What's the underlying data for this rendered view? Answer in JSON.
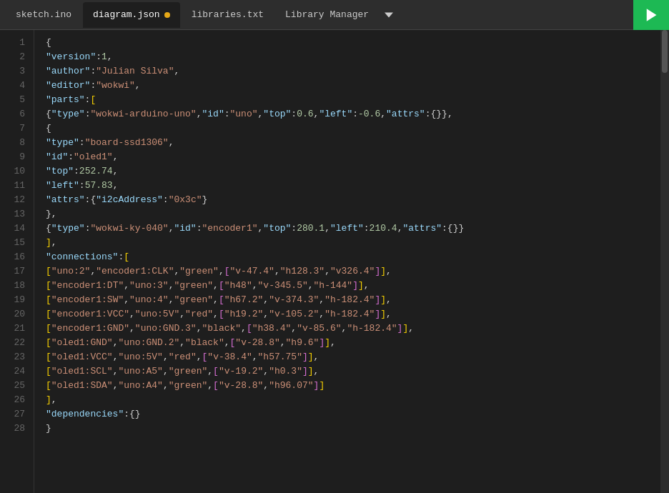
{
  "tabs": [
    {
      "id": "sketch",
      "label": "sketch.ino",
      "active": false,
      "modified": false
    },
    {
      "id": "diagram",
      "label": "diagram.json",
      "active": true,
      "modified": true
    },
    {
      "id": "libraries",
      "label": "libraries.txt",
      "active": false,
      "modified": false
    },
    {
      "id": "libmanager",
      "label": "Library Manager",
      "active": false,
      "modified": false
    }
  ],
  "run_button_title": "Run",
  "lines": [
    {
      "num": 1,
      "html": "<span class='s-brace'>{</span>"
    },
    {
      "num": 2,
      "html": "  <span class='s-key'>\"version\"</span><span class='s-colon'>:</span> <span class='s-num'>1</span><span class='s-comma'>,</span>"
    },
    {
      "num": 3,
      "html": "  <span class='s-key'>\"author\"</span><span class='s-colon'>:</span> <span class='s-str'>\"Julian Silva\"</span><span class='s-comma'>,</span>"
    },
    {
      "num": 4,
      "html": "  <span class='s-key'>\"editor\"</span><span class='s-colon'>:</span> <span class='s-str'>\"wokwi\"</span><span class='s-comma'>,</span>"
    },
    {
      "num": 5,
      "html": "  <span class='s-key'>\"parts\"</span><span class='s-colon'>:</span> <span class='s-bracket'>[</span>"
    },
    {
      "num": 6,
      "html": "    <span class='s-brace'>{</span> <span class='s-key'>\"type\"</span><span class='s-colon'>:</span> <span class='s-str'>\"wokwi-arduino-uno\"</span><span class='s-comma'>,</span> <span class='s-key'>\"id\"</span><span class='s-colon'>:</span> <span class='s-str'>\"uno\"</span><span class='s-comma'>,</span> <span class='s-key'>\"top\"</span><span class='s-colon'>:</span> <span class='s-num'>0.6</span><span class='s-comma'>,</span> <span class='s-key'>\"left\"</span><span class='s-colon'>:</span> <span class='s-num'>-0.6</span><span class='s-comma'>,</span> <span class='s-key'>\"attrs\"</span><span class='s-colon'>:</span> <span class='s-brace'>{}</span> <span class='s-brace'>}</span><span class='s-comma'>,</span>"
    },
    {
      "num": 7,
      "html": "    <span class='s-brace'>{</span>"
    },
    {
      "num": 8,
      "html": "      <span class='s-key'>\"type\"</span><span class='s-colon'>:</span> <span class='s-str'>\"board-ssd1306\"</span><span class='s-comma'>,</span>"
    },
    {
      "num": 9,
      "html": "      <span class='s-key'>\"id\"</span><span class='s-colon'>:</span> <span class='s-str'>\"oled1\"</span><span class='s-comma'>,</span>"
    },
    {
      "num": 10,
      "html": "      <span class='s-key'>\"top\"</span><span class='s-colon'>:</span> <span class='s-num'>252.74</span><span class='s-comma'>,</span>"
    },
    {
      "num": 11,
      "html": "      <span class='s-key'>\"left\"</span><span class='s-colon'>:</span> <span class='s-num'>57.83</span><span class='s-comma'>,</span>"
    },
    {
      "num": 12,
      "html": "      <span class='s-key'>\"attrs\"</span><span class='s-colon'>:</span> <span class='s-brace'>{</span> <span class='s-key'>\"i2cAddress\"</span><span class='s-colon'>:</span> <span class='s-str'>\"0x3c\"</span> <span class='s-brace'>}</span>"
    },
    {
      "num": 13,
      "html": "    <span class='s-brace'>}</span><span class='s-comma'>,</span>"
    },
    {
      "num": 14,
      "html": "    <span class='s-brace'>{</span> <span class='s-key'>\"type\"</span><span class='s-colon'>:</span> <span class='s-str'>\"wokwi-ky-040\"</span><span class='s-comma'>,</span> <span class='s-key'>\"id\"</span><span class='s-colon'>:</span> <span class='s-str'>\"encoder1\"</span><span class='s-comma'>,</span> <span class='s-key'>\"top\"</span><span class='s-colon'>:</span> <span class='s-num'>280.1</span><span class='s-comma'>,</span> <span class='s-key'>\"left\"</span><span class='s-colon'>:</span> <span class='s-num'>210.4</span><span class='s-comma'>,</span> <span class='s-key'>\"attrs\"</span><span class='s-colon'>:</span> <span class='s-brace'>{}</span> <span class='s-brace'>}</span>"
    },
    {
      "num": 15,
      "html": "  <span class='s-bracket'>]</span><span class='s-comma'>,</span>"
    },
    {
      "num": 16,
      "html": "  <span class='s-key'>\"connections\"</span><span class='s-colon'>:</span> <span class='s-bracket'>[</span>"
    },
    {
      "num": 17,
      "html": "    <span class='s-bracket'>[</span> <span class='s-str'>\"uno:2\"</span><span class='s-comma'>,</span> <span class='s-str'>\"encoder1:CLK\"</span><span class='s-comma'>,</span> <span class='s-str'>\"green\"</span><span class='s-comma'>,</span> <span class='s-inner-bracket'>[</span> <span class='s-str'>\"v-47.4\"</span><span class='s-comma'>,</span> <span class='s-str'>\"h128.3\"</span><span class='s-comma'>,</span> <span class='s-str'>\"v326.4\"</span> <span class='s-inner-bracket'>]</span> <span class='s-bracket'>]</span><span class='s-comma'>,</span>"
    },
    {
      "num": 18,
      "html": "    <span class='s-bracket'>[</span> <span class='s-str'>\"encoder1:DT\"</span><span class='s-comma'>,</span> <span class='s-str'>\"uno:3\"</span><span class='s-comma'>,</span> <span class='s-str'>\"green\"</span><span class='s-comma'>,</span> <span class='s-inner-bracket'>[</span> <span class='s-str'>\"h48\"</span><span class='s-comma'>,</span> <span class='s-str'>\"v-345.5\"</span><span class='s-comma'>,</span> <span class='s-str'>\"h-144\"</span> <span class='s-inner-bracket'>]</span> <span class='s-bracket'>]</span><span class='s-comma'>,</span>"
    },
    {
      "num": 19,
      "html": "    <span class='s-bracket'>[</span> <span class='s-str'>\"encoder1:SW\"</span><span class='s-comma'>,</span> <span class='s-str'>\"uno:4\"</span><span class='s-comma'>,</span> <span class='s-str'>\"green\"</span><span class='s-comma'>,</span> <span class='s-inner-bracket'>[</span> <span class='s-str'>\"h67.2\"</span><span class='s-comma'>,</span> <span class='s-str'>\"v-374.3\"</span><span class='s-comma'>,</span> <span class='s-str'>\"h-182.4\"</span> <span class='s-inner-bracket'>]</span> <span class='s-bracket'>]</span><span class='s-comma'>,</span>"
    },
    {
      "num": 20,
      "html": "    <span class='s-bracket'>[</span> <span class='s-str'>\"encoder1:VCC\"</span><span class='s-comma'>,</span> <span class='s-str'>\"uno:5V\"</span><span class='s-comma'>,</span> <span class='s-str' style='color:#ce9178'>\"red\"</span><span class='s-comma'>,</span> <span class='s-inner-bracket'>[</span> <span class='s-str'>\"h19.2\"</span><span class='s-comma'>,</span> <span class='s-str'>\"v-105.2\"</span><span class='s-comma'>,</span> <span class='s-str'>\"h-182.4\"</span> <span class='s-inner-bracket'>]</span> <span class='s-bracket'>]</span><span class='s-comma'>,</span>"
    },
    {
      "num": 21,
      "html": "    <span class='s-bracket'>[</span> <span class='s-str'>\"encoder1:GND\"</span><span class='s-comma'>,</span> <span class='s-str'>\"uno:GND.3\"</span><span class='s-comma'>,</span> <span class='s-str' style='color:#ce9178'>\"black\"</span><span class='s-comma'>,</span> <span class='s-inner-bracket'>[</span> <span class='s-str'>\"h38.4\"</span><span class='s-comma'>,</span> <span class='s-str'>\"v-85.6\"</span><span class='s-comma'>,</span> <span class='s-str'>\"h-182.4\"</span> <span class='s-inner-bracket'>]</span> <span class='s-bracket'>]</span><span class='s-comma'>,</span>"
    },
    {
      "num": 22,
      "html": "    <span class='s-bracket'>[</span> <span class='s-str'>\"oled1:GND\"</span><span class='s-comma'>,</span> <span class='s-str'>\"uno:GND.2\"</span><span class='s-comma'>,</span> <span class='s-str' style='color:#ce9178'>\"black\"</span><span class='s-comma'>,</span> <span class='s-inner-bracket'>[</span> <span class='s-str'>\"v-28.8\"</span><span class='s-comma'>,</span> <span class='s-str'>\"h9.6\"</span> <span class='s-inner-bracket'>]</span> <span class='s-bracket'>]</span><span class='s-comma'>,</span>"
    },
    {
      "num": 23,
      "html": "    <span class='s-bracket'>[</span> <span class='s-str'>\"oled1:VCC\"</span><span class='s-comma'>,</span> <span class='s-str'>\"uno:5V\"</span><span class='s-comma'>,</span> <span class='s-str' style='color:#ce9178'>\"red\"</span><span class='s-comma'>,</span> <span class='s-inner-bracket'>[</span> <span class='s-str'>\"v-38.4\"</span><span class='s-comma'>,</span> <span class='s-str'>\"h57.75\"</span> <span class='s-inner-bracket'>]</span> <span class='s-bracket'>]</span><span class='s-comma'>,</span>"
    },
    {
      "num": 24,
      "html": "    <span class='s-bracket'>[</span> <span class='s-str'>\"oled1:SCL\"</span><span class='s-comma'>,</span> <span class='s-str'>\"uno:A5\"</span><span class='s-comma'>,</span> <span class='s-str'>\"green\"</span><span class='s-comma'>,</span> <span class='s-inner-bracket'>[</span> <span class='s-str'>\"v-19.2\"</span><span class='s-comma'>,</span> <span class='s-str'>\"h0.3\"</span> <span class='s-inner-bracket'>]</span> <span class='s-bracket'>]</span><span class='s-comma'>,</span>"
    },
    {
      "num": 25,
      "html": "    <span class='s-bracket'>[</span> <span class='s-str'>\"oled1:SDA\"</span><span class='s-comma'>,</span> <span class='s-str'>\"uno:A4\"</span><span class='s-comma'>,</span> <span class='s-str'>\"green\"</span><span class='s-comma'>,</span> <span class='s-inner-bracket'>[</span> <span class='s-str'>\"v-28.8\"</span><span class='s-comma'>,</span> <span class='s-str'>\"h96.07\"</span> <span class='s-inner-bracket'>]</span> <span class='s-bracket'>]</span>"
    },
    {
      "num": 26,
      "html": "  <span class='s-bracket'>]</span><span class='s-comma'>,</span>"
    },
    {
      "num": 27,
      "html": "  <span class='s-key'>\"dependencies\"</span><span class='s-colon'>:</span> <span class='s-brace'>{}</span>"
    },
    {
      "num": 28,
      "html": "<span class='s-brace'>}</span>"
    }
  ]
}
